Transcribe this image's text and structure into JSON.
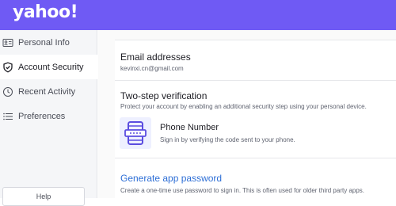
{
  "header": {
    "logo": "yahoo!"
  },
  "sidebar": {
    "items": [
      {
        "label": "Personal Info",
        "icon": "id-card-icon"
      },
      {
        "label": "Account Security",
        "icon": "shield-icon"
      },
      {
        "label": "Recent Activity",
        "icon": "clock-icon"
      },
      {
        "label": "Preferences",
        "icon": "list-icon"
      }
    ],
    "help_label": "Help"
  },
  "main": {
    "email": {
      "title": "Email addresses",
      "value": "kevinxi.cn@gmail.com"
    },
    "two_step": {
      "title": "Two-step verification",
      "description": "Protect your account by enabling an additional security step using your personal device.",
      "phone_title": "Phone Number",
      "phone_desc": "Sign in by verifying the code sent to your phone."
    },
    "app_password": {
      "link": "Generate app password",
      "description": "Create a one-time use password to sign in. This is often used for older third party apps."
    }
  },
  "colors": {
    "brand": "#6f5af4",
    "link": "#2e6fd6",
    "icon": "#5b4de0"
  }
}
